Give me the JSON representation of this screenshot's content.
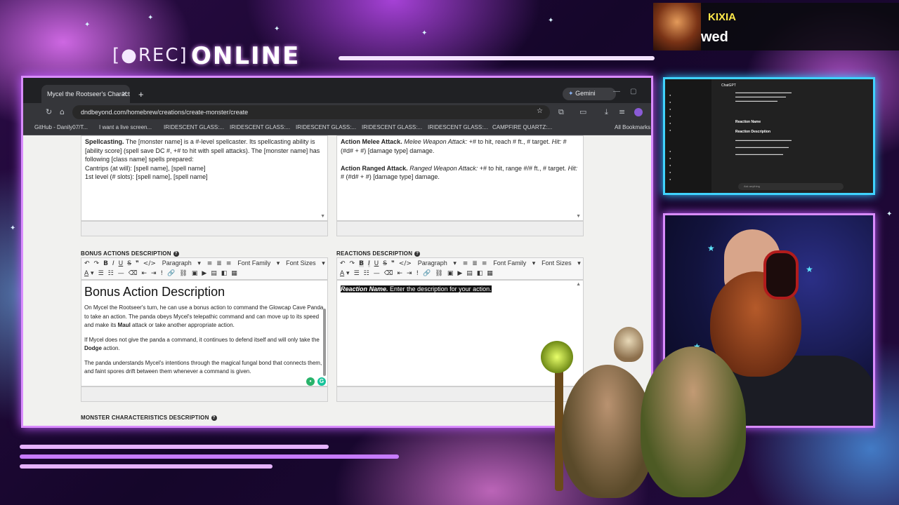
{
  "overlay": {
    "rec_label": "[●REC]",
    "online_label": "ONLINE"
  },
  "follow_alert": {
    "name": "KIXIA",
    "message": "wed"
  },
  "browser": {
    "tab_title": "Mycel the Rootseer's Characte",
    "gemini_label": "Gemini",
    "url": "dndbeyond.com/homebrew/creations/create-monster/create",
    "bookmarks": [
      "GitHub - Danily07/T...",
      "I want a live screen...",
      "IRIDESCENT GLASS:...",
      "IRIDESCENT GLASS:...",
      "IRIDESCENT GLASS:...",
      "IRIDESCENT GLASS:...",
      "IRIDESCENT GLASS:...",
      "CAMPFIRE QUARTZ:...",
      "All Bookmarks"
    ]
  },
  "spellcasting_box": {
    "lead": "Spellcasting.",
    "text": " The [monster name] is a #-level spellcaster. Its spellcasting ability is [ability score] (spell save DC #, +# to hit with spell attacks). The [monster name] has following [class name] spells prepared:",
    "line_cantrips": "Cantrips (at will): [spell name], [spell name]",
    "line_first": "1st level (# slots): [spell name], [spell name]"
  },
  "attacks_box": {
    "melee_lead": "Action Melee Attack.",
    "melee_italic": " Melee Weapon Attack:",
    "melee_text": " +# to hit, reach # ft., # target.",
    "melee_hit": " Hit:",
    "melee_tail": " # (#d# + #) [damage type] damage.",
    "ranged_lead": "Action Ranged Attack.",
    "ranged_italic": " Ranged Weapon Attack:",
    "ranged_text": " +# to hit, range #/# ft., # target.",
    "ranged_hit": " Hit:",
    "ranged_tail": " # (#d# + #) [damage type] damage."
  },
  "bonus_section": {
    "label": "BONUS ACTIONS DESCRIPTION",
    "heading": "Bonus Action Description",
    "p1": "On Mycel the Rootseer's turn, he can use a bonus action to command the Glowcap Cave Panda to take an action. The panda obeys Mycel's telepathic command and can move up to its speed and make its ",
    "p1_bold": "Maul",
    "p1_tail": " attack or take another appropriate action.",
    "p2": "If Mycel does not give the panda a command, it continues to defend itself and will only take the ",
    "p2_bold": "Dodge",
    "p2_tail": " action.",
    "p3": "The panda understands Mycel's intentions through the magical fungal bond that connects them, and faint spores drift between them whenever a command is given."
  },
  "reactions_section": {
    "label": "REACTIONS DESCRIPTION",
    "lead": "Reaction Name.",
    "text": " Enter the description for your action."
  },
  "monster_char_label": "MONSTER CHARACTERISTICS DESCRIPTION",
  "toolbar": {
    "paragraph": "Paragraph",
    "font_family": "Font Family",
    "font_sizes": "Font Sizes"
  },
  "chat_panel": {
    "title": "ChatGPT",
    "heading1": "Reaction Name",
    "heading2": "Reaction Description",
    "input_placeholder": "Ask anything"
  },
  "colors": {
    "neon_pink": "#d98cff",
    "neon_blue": "#3fd3ff",
    "alert_yellow": "#ffe94a"
  }
}
